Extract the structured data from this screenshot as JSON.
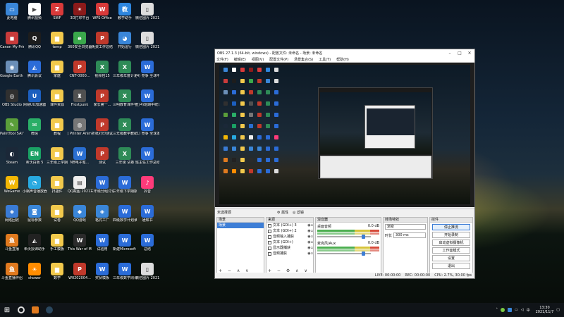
{
  "desktop_icons": [
    {
      "label": "此电脑",
      "color": "#3a86d8",
      "glyph": "▭"
    },
    {
      "label": "Canon My Printer",
      "color": "#c93b3b",
      "glyph": "◼"
    },
    {
      "label": "Google Earth Pro",
      "color": "#6b8fb8",
      "glyph": "◉"
    },
    {
      "label": "OBS Studio",
      "color": "#303030",
      "glyph": "◎"
    },
    {
      "label": "PaintTool SAI Ver.1",
      "color": "#5a9e3a",
      "glyph": "✎"
    },
    {
      "label": "Steam",
      "color": "#1b2838",
      "glyph": "◐"
    },
    {
      "label": "WeGame",
      "color": "#f2b705",
      "glyph": "W"
    },
    {
      "label": "网络回收",
      "color": "#3a7bd5",
      "glyph": "◈"
    },
    {
      "label": "斗鱼直播",
      "color": "#e07a1f",
      "glyph": "鱼"
    },
    {
      "label": "斗鱼直播伴侣",
      "color": "#e07a1f",
      "glyph": "鱼"
    },
    {
      "label": "腾讯视频",
      "color": "#ffffff",
      "glyph": "▶"
    },
    {
      "label": "腾讯QQ",
      "color": "#1d1d1d",
      "glyph": "Q"
    },
    {
      "label": "腾讯会议",
      "color": "#2b6cd8",
      "glyph": "◭"
    },
    {
      "label": "网易UU加速器",
      "color": "#1c5fbf",
      "glyph": "U"
    },
    {
      "label": "微信",
      "color": "#2aae67",
      "glyph": "✉"
    },
    {
      "label": "希沃白板 5",
      "color": "#1aa164",
      "glyph": "EN"
    },
    {
      "label": "小蜗声音播放器",
      "color": "#28a9e0",
      "glyph": "◔"
    },
    {
      "label": "鼠标参数",
      "color": "#3a86d8",
      "glyph": "◙"
    },
    {
      "label": "希沃授课助手",
      "color": "#222222",
      "glyph": "◭"
    },
    {
      "label": "shower",
      "color": "#ff8c00",
      "glyph": "☀"
    },
    {
      "label": "SWF",
      "color": "#d93a3a",
      "glyph": "Z"
    },
    {
      "label": "temp",
      "color": "#f2c94c",
      "glyph": "▆"
    },
    {
      "label": "家庭",
      "color": "#f2c94c",
      "glyph": "▆"
    },
    {
      "label": "课件资源",
      "color": "#f2c94c",
      "glyph": "▆"
    },
    {
      "label": "教程",
      "color": "#f2c94c",
      "glyph": "▆"
    },
    {
      "label": "三年级上学期",
      "color": "#f2c94c",
      "glyph": "▆"
    },
    {
      "label": "扫描件",
      "color": "#f2c94c",
      "glyph": "▆"
    },
    {
      "label": "试卷",
      "color": "#f2c94c",
      "glyph": "▆"
    },
    {
      "label": "手工模板",
      "color": "#f2c94c",
      "glyph": "▆"
    },
    {
      "label": "数学",
      "color": "#f2c94c",
      "glyph": "▆"
    },
    {
      "label": "3D打印平台",
      "color": "#8b1a1a",
      "glyph": "✶"
    },
    {
      "label": "360安全浏览器",
      "color": "#3aa84b",
      "glyph": "e"
    },
    {
      "label": "CNT-0000...",
      "color": "#c0392b",
      "glyph": "P"
    },
    {
      "label": "Frostpunk",
      "color": "#505050",
      "glyph": "♜"
    },
    {
      "label": "J Printer Anime...",
      "color": "#777777",
      "glyph": "◍"
    },
    {
      "label": "NB电子笔...",
      "color": "#2a6fd1",
      "glyph": "W"
    },
    {
      "label": "QQ截图 20211031...",
      "color": "#eeeeee",
      "glyph": "▤"
    },
    {
      "label": "QQ游戏",
      "color": "#3a86d8",
      "glyph": "◆"
    },
    {
      "label": "This War of Mine",
      "color": "#2b2b2b",
      "glyph": "W"
    },
    {
      "label": "W0202004...",
      "color": "#c0392b",
      "glyph": "P"
    },
    {
      "label": "WPS Office",
      "color": "#d93a3a",
      "glyph": "W"
    },
    {
      "label": "免费工作总结",
      "color": "#c0392b",
      "glyph": "P"
    },
    {
      "label": "视频包15",
      "color": "#2e8b57",
      "glyph": "X"
    },
    {
      "label": "家长第一...",
      "color": "#c0392b",
      "glyph": "P"
    },
    {
      "label": "折纸打印测试",
      "color": "#c0392b",
      "glyph": "P"
    },
    {
      "label": "测试",
      "color": "#c0392b",
      "glyph": "P"
    },
    {
      "label": "三年级分组讨论",
      "color": "#2b6cd8",
      "glyph": "W"
    },
    {
      "label": "格式工厂",
      "color": "#3a86d8",
      "glyph": "◈"
    },
    {
      "label": "试验用",
      "color": "#2b6cd8",
      "glyph": "W"
    },
    {
      "label": "奖状模板",
      "color": "#2b6cd8",
      "glyph": "W"
    },
    {
      "label": "教学助手",
      "color": "#2e86de",
      "glyph": "教"
    },
    {
      "label": "开始运行",
      "color": "#3a86d8",
      "glyph": "◕"
    },
    {
      "label": "三年级年度计划",
      "color": "#2e8b57",
      "glyph": "X"
    },
    {
      "label": "三明教育课件学生练习",
      "color": "#2e8b57",
      "glyph": "X"
    },
    {
      "label": "三年级教学教研",
      "color": "#2e8b57",
      "glyph": "X"
    },
    {
      "label": "三年级 试卷",
      "color": "#2e8b57",
      "glyph": "X"
    },
    {
      "label": "三年级下学期期末",
      "color": "#2b6cd8",
      "glyph": "W"
    },
    {
      "label": "四级数学计划读书卡",
      "color": "#2b6cd8",
      "glyph": "W"
    },
    {
      "label": "新建Microsoft Word",
      "color": "#2b6cd8",
      "glyph": "W"
    },
    {
      "label": "三年级数学周计划",
      "color": "#2b6cd8",
      "glyph": "W"
    },
    {
      "label": "微信图片 202104...",
      "color": "#dddddd",
      "glyph": "▯"
    },
    {
      "label": "微信图片 202104...",
      "color": "#dddddd",
      "glyph": "▯"
    },
    {
      "label": "(4) 竞争 全球中国教育",
      "color": "#2b6cd8",
      "glyph": "W"
    },
    {
      "label": "五(4)班期中统计成绩",
      "color": "#2b6cd8",
      "glyph": "W"
    },
    {
      "label": "(1) 竞争 全球发展",
      "color": "#2b6cd8",
      "glyph": "W"
    },
    {
      "label": "班主任工作总结",
      "color": "#2b6cd8",
      "glyph": "W"
    },
    {
      "label": "抖音",
      "color": "#ff3b7a",
      "glyph": "♪"
    },
    {
      "label": "通知书",
      "color": "#2b6cd8",
      "glyph": "W"
    },
    {
      "label": "总结",
      "color": "#2b6cd8",
      "glyph": "W"
    },
    {
      "label": "微信图片 2021041...",
      "color": "#dddddd",
      "glyph": "▯"
    }
  ],
  "obs": {
    "title": "OBS 27.1.3 (64-bit, windows) - 配置文件: 未命名 - 场景: 未命名",
    "menu": [
      "文件(F)",
      "编辑(E)",
      "视图(V)",
      "配置文件(P)",
      "场景集合(S)",
      "工具(T)",
      "帮助(H)"
    ],
    "no_source_label": "未选择源",
    "props_label": "⚙ 属性",
    "filter_label": "◎ 滤镜",
    "docks": {
      "scenes": {
        "title": "场景",
        "items": [
          "场景"
        ]
      },
      "sources": {
        "title": "来源",
        "items": [
          {
            "name": "文本 (GDI+) 3"
          },
          {
            "name": "文本 (GDI+) 2"
          },
          {
            "name": "音频输入捕获"
          },
          {
            "name": "文本 (GDI+)"
          },
          {
            "name": "显示器捕获"
          },
          {
            "name": "音频捕获"
          }
        ]
      },
      "mixer": {
        "title": "混音器",
        "channels": [
          {
            "name": "桌面音频",
            "db": "0.0 dB"
          },
          {
            "name": "麦克风/Aux",
            "db": "0.0 dB"
          }
        ]
      },
      "transitions": {
        "title": "转场特效",
        "type": "渐变",
        "duration_label": "时长",
        "duration_value": "300 ms"
      },
      "controls": {
        "title": "控件",
        "buttons": [
          "停止推流",
          "开始录制",
          "启动虚拟摄像机",
          "工作室模式",
          "设置",
          "退出"
        ]
      }
    },
    "status": {
      "live": "LIVE: 00:00:00",
      "rec": "REC: 00:00:00",
      "cpu": "CPU: 2.7%, 30.00 fps"
    }
  },
  "taskbar": {
    "start_glyph": "⊞",
    "time": "13:30",
    "date": "2021/11/7",
    "lang": "中"
  }
}
